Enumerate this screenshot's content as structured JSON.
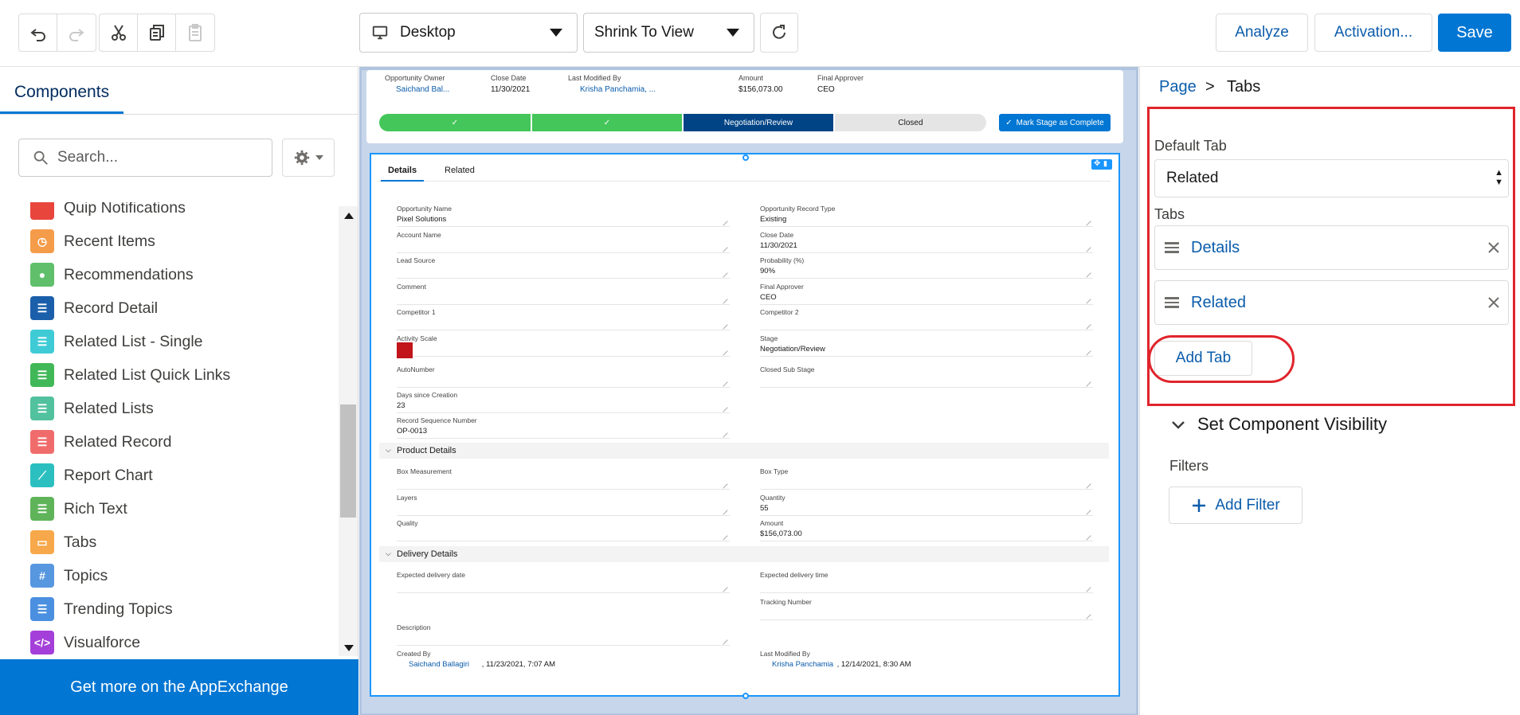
{
  "toolbar": {
    "undo_icon": "undo-icon",
    "redo_icon": "redo-icon",
    "cut_icon": "cut-icon",
    "copy_icon": "copy-icon",
    "paste_icon": "paste-icon",
    "device_select": "Desktop",
    "view_select": "Shrink To View",
    "analyze_label": "Analyze",
    "activation_label": "Activation...",
    "save_label": "Save",
    "accent_color": "#0176d3"
  },
  "left_panel": {
    "tab_label": "Components",
    "search_placeholder": "Search...",
    "appexchange_label": "Get more on the AppExchange",
    "items": [
      {
        "label": "Quip Notifications",
        "color": "#e8453c"
      },
      {
        "label": "Recent Items",
        "color": "#f49c4a"
      },
      {
        "label": "Recommendations",
        "color": "#5fbf6a"
      },
      {
        "label": "Record Detail",
        "color": "#1b5faa"
      },
      {
        "label": "Related List - Single",
        "color": "#3fcbd5"
      },
      {
        "label": "Related List Quick Links",
        "color": "#41b858"
      },
      {
        "label": "Related Lists",
        "color": "#52c19d"
      },
      {
        "label": "Related Record",
        "color": "#f06c6c"
      },
      {
        "label": "Report Chart",
        "color": "#2bbfc0"
      },
      {
        "label": "Rich Text",
        "color": "#5fb45a"
      },
      {
        "label": "Tabs",
        "color": "#f7a84a"
      },
      {
        "label": "Topics",
        "color": "#5797e0"
      },
      {
        "label": "Trending Topics",
        "color": "#4a8fe0"
      },
      {
        "label": "Visualforce",
        "color": "#a43fd9"
      }
    ]
  },
  "canvas": {
    "highlights": {
      "owner_label": "Opportunity Owner",
      "owner_value": "Saichand Bal...",
      "close_label": "Close Date",
      "close_value": "11/30/2021",
      "modified_label": "Last Modified By",
      "modified_value": "Krisha Panchamia, ...",
      "amount_label": "Amount",
      "amount_value": "$156,073.00",
      "approver_label": "Final Approver",
      "approver_value": "CEO"
    },
    "path": {
      "stage_current": "Negotiation/Review",
      "stage_next": "Closed",
      "mark_button": "Mark Stage as Complete",
      "check": "✓"
    },
    "tabs": [
      "Details",
      "Related"
    ],
    "fields_left": [
      {
        "label": "Opportunity Name",
        "value": "Pixel Solutions"
      },
      {
        "label": "Account Name",
        "value": ""
      },
      {
        "label": "Lead Source",
        "value": ""
      },
      {
        "label": "Comment",
        "value": ""
      },
      {
        "label": "Competitor 1",
        "value": ""
      },
      {
        "label": "Activity Scale",
        "value": ""
      },
      {
        "label": "AutoNumber",
        "value": ""
      },
      {
        "label": "Days since Creation",
        "value": "23"
      },
      {
        "label": "Record Sequence Number",
        "value": "OP-0013"
      }
    ],
    "fields_right": [
      {
        "label": "Opportunity Record Type",
        "value": "Existing"
      },
      {
        "label": "Close Date",
        "value": "11/30/2021"
      },
      {
        "label": "Probability (%)",
        "value": "90%"
      },
      {
        "label": "Final Approver",
        "value": "CEO"
      },
      {
        "label": "Competitor 2",
        "value": ""
      },
      {
        "label": "Stage",
        "value": "Negotiation/Review"
      },
      {
        "label": "Closed Sub Stage",
        "value": ""
      }
    ],
    "product_section": "Product Details",
    "product_left": [
      {
        "label": "Box Measurement",
        "value": ""
      },
      {
        "label": "Layers",
        "value": ""
      },
      {
        "label": "Quality",
        "value": ""
      }
    ],
    "product_right": [
      {
        "label": "Box Type",
        "value": ""
      },
      {
        "label": "Quantity",
        "value": "55"
      },
      {
        "label": "Amount",
        "value": "$156,073.00"
      }
    ],
    "delivery_section": "Delivery Details",
    "delivery_left": [
      {
        "label": "Expected delivery date",
        "value": ""
      },
      {
        "label": "Description",
        "value": ""
      },
      {
        "label": "Created By",
        "value": "Saichand Ballagiri",
        "suffix": ", 11/23/2021, 7:07 AM"
      }
    ],
    "delivery_right": [
      {
        "label": "Expected delivery time",
        "value": ""
      },
      {
        "label": "Tracking Number",
        "value": ""
      },
      {
        "label": "Last Modified By",
        "value": "Krisha Panchamia",
        "suffix": ", 12/14/2021, 8:30 AM"
      }
    ]
  },
  "right_panel": {
    "crumb_page": "Page",
    "crumb_sep": ">",
    "crumb_current": "Tabs",
    "default_tab_label": "Default Tab",
    "default_tab_value": "Related",
    "tabs_label": "Tabs",
    "tabs": [
      "Details",
      "Related"
    ],
    "add_tab_label": "Add Tab",
    "visibility_label": "Set Component Visibility",
    "filters_label": "Filters",
    "add_filter_label": "Add Filter",
    "highlight_color": "#e0242b"
  }
}
